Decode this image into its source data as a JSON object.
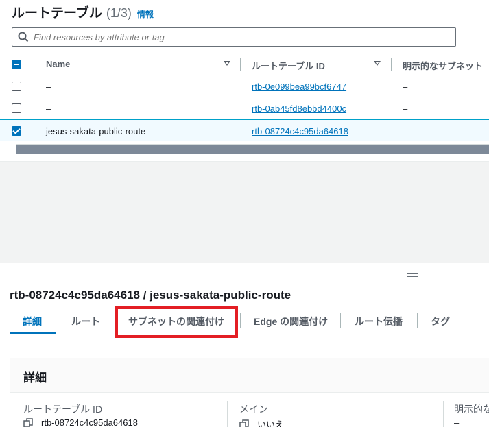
{
  "header": {
    "title": "ルートテーブル",
    "count": "(1/3)",
    "info_link": "情報"
  },
  "search": {
    "placeholder": "Find resources by attribute or tag"
  },
  "table": {
    "columns": {
      "name": "Name",
      "route_table_id": "ルートテーブル ID",
      "explicit_subnet": "明示的なサブネット"
    },
    "rows": [
      {
        "name": "–",
        "route_table_id": "rtb-0e099bea99bcf6747",
        "explicit_subnet": "–",
        "selected": false
      },
      {
        "name": "–",
        "route_table_id": "rtb-0ab45fd8ebbd4400c",
        "explicit_subnet": "–",
        "selected": false
      },
      {
        "name": "jesus-sakata-public-route",
        "route_table_id": "rtb-08724c4c95da64618",
        "explicit_subnet": "–",
        "selected": true
      }
    ]
  },
  "detail": {
    "title": "rtb-08724c4c95da64618 / jesus-sakata-public-route",
    "tabs": [
      "詳細",
      "ルート",
      "サブネットの関連付け",
      "Edge の関連付け",
      "ルート伝播",
      "タグ"
    ],
    "active_tab": "詳細",
    "highlighted_tab": "サブネットの関連付け",
    "card": {
      "title": "詳細",
      "fields": [
        {
          "label": "ルートテーブル ID",
          "value": "rtb-08724c4c95da64618"
        },
        {
          "label": "メイン",
          "value": "いいえ"
        },
        {
          "label": "明示的な",
          "value": "–"
        }
      ]
    }
  },
  "colors": {
    "accent": "#0073bb",
    "highlight": "#e31e24",
    "text": "#16191f",
    "muted": "#545b64"
  }
}
